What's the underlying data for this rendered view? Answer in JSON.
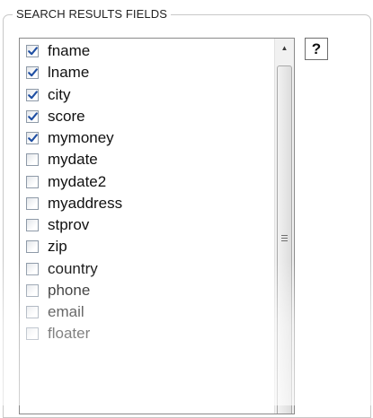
{
  "section": {
    "legend": "SEARCH RESULTS FIELDS"
  },
  "help_button": {
    "label": "?"
  },
  "fields": [
    {
      "label": "fname",
      "checked": true
    },
    {
      "label": "lname",
      "checked": true
    },
    {
      "label": "city",
      "checked": true
    },
    {
      "label": "score",
      "checked": true
    },
    {
      "label": "mymoney",
      "checked": true
    },
    {
      "label": "mydate",
      "checked": false
    },
    {
      "label": "mydate2",
      "checked": false
    },
    {
      "label": "myaddress",
      "checked": false
    },
    {
      "label": "stprov",
      "checked": false
    },
    {
      "label": "zip",
      "checked": false
    },
    {
      "label": "country",
      "checked": false
    },
    {
      "label": "phone",
      "checked": false
    },
    {
      "label": "email",
      "checked": false
    },
    {
      "label": "floater",
      "checked": false
    }
  ],
  "scrollbar": {
    "up_arrow_icon": "triangle-up-icon",
    "grip_icon": "scroll-grip-icon"
  },
  "colors": {
    "check": "#1f4fa3",
    "checkbox_border": "#8e9aa8"
  }
}
